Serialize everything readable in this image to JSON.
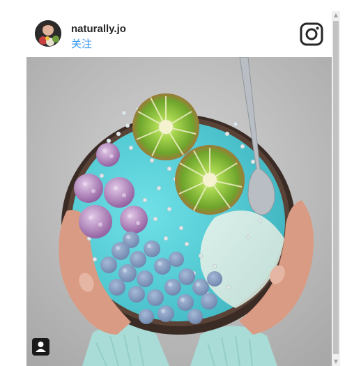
{
  "post": {
    "username": "naturally.jo",
    "follow_label": "关注"
  },
  "icons": {
    "logo": "instagram-icon",
    "user_tag": "user-tag-icon",
    "scroll_up": "chevron-up-icon",
    "scroll_down": "chevron-down-icon"
  },
  "photo": {
    "description_subject": "smoothie bowl",
    "colors": {
      "smoothie": "#5ecfd6",
      "kiwi": "#8fc446",
      "raspberry": "#9e6ba8",
      "blueberry": "#8aa3c9",
      "sweater": "#a9dcd6"
    }
  },
  "scroll": {
    "up_glyph": "▲",
    "down_glyph": "▼"
  }
}
